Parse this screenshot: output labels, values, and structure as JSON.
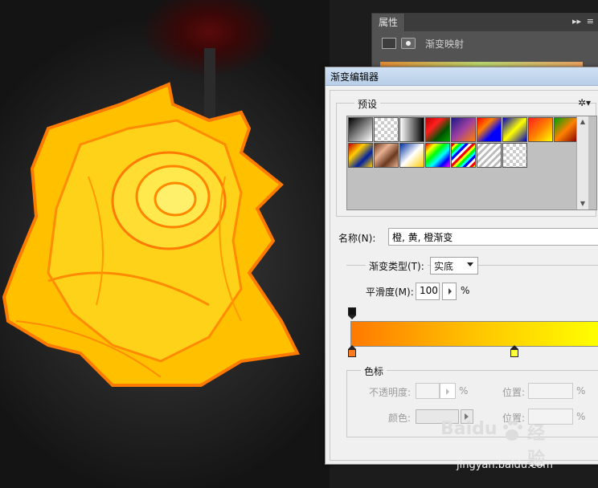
{
  "properties_panel": {
    "tab_label": "属性",
    "adjustment_name": "渐变映射",
    "menu_icon": "panel-menu-icon",
    "close_icon": "close-icon"
  },
  "dialog": {
    "title": "渐变编辑器",
    "presets_label": "预设",
    "gear_icon": "gear-icon",
    "presets": [
      {
        "gradient": "linear-gradient(135deg,#000,#fff)"
      },
      {
        "gradient": "repeating-conic-gradient(#ccc 0 25%,#fff 0 50%)"
      },
      {
        "gradient": "linear-gradient(90deg,#fff,#000)"
      },
      {
        "gradient": "linear-gradient(135deg,#c00000,#ff2020,#005000,#00a000)"
      },
      {
        "gradient": "linear-gradient(135deg,#1a1a8a,#a040a0,#ff8000)"
      },
      {
        "gradient": "linear-gradient(135deg,#ff0000,#ff8000,#0000ff,#0000ff)"
      },
      {
        "gradient": "linear-gradient(135deg,#0000c0,#ffff00,#0000c0)"
      },
      {
        "gradient": "linear-gradient(135deg,#ff2020,#ff8000,#ffff00)"
      },
      {
        "gradient": "linear-gradient(135deg,#00a000,#ff8000,#800000)"
      },
      {
        "gradient": "linear-gradient(135deg,#c00000,#ffcc00,#0020a0,#ffcc00)"
      },
      {
        "gradient": "linear-gradient(135deg,#6a3a20,#e8b090,#6a3a20,#e8b090)"
      },
      {
        "gradient": "linear-gradient(135deg,#0030a0,#fff,#ffcc00)"
      },
      {
        "gradient": "linear-gradient(135deg,#ff0000,#ffff00,#00ff00,#00ffff,#0000ff,#ff00ff)"
      },
      {
        "gradient": "repeating-linear-gradient(135deg,#ff0000 0 3px,#ffff00 3px 6px,#00ff00 6px 9px,#00ffff 9px 12px,#0000ff 12px 15px,#fff 15px 18px)"
      },
      {
        "gradient": "repeating-linear-gradient(135deg,#fff 0 3px,#bbb 3px 6px)"
      },
      {
        "gradient": "repeating-conic-gradient(#ccc 0 25%,#fff 0 50%)"
      }
    ],
    "name_label": "名称(N):",
    "name_value": "橙, 黄, 橙渐变",
    "type_label": "渐变类型(T):",
    "type_value": "实底",
    "smooth_label": "平滑度(M):",
    "smooth_value": "100",
    "smooth_unit": "%",
    "gradient_colors": [
      "#ff7a00",
      "#ffc400",
      "#ffff00"
    ],
    "stops_label": "色标",
    "opacity_label": "不透明度:",
    "opacity_unit": "%",
    "opacity_location_label": "位置:",
    "opacity_location_unit": "%",
    "color_label": "颜色:",
    "color_location_label": "位置:",
    "color_location_unit": "%",
    "stop_colors": {
      "top": "#111111",
      "left": "#ff7a1a",
      "mid": "#ffff40"
    }
  },
  "watermark": {
    "text": "Baidu",
    "cn": "经验",
    "url": "jingyan.baidu.com"
  }
}
